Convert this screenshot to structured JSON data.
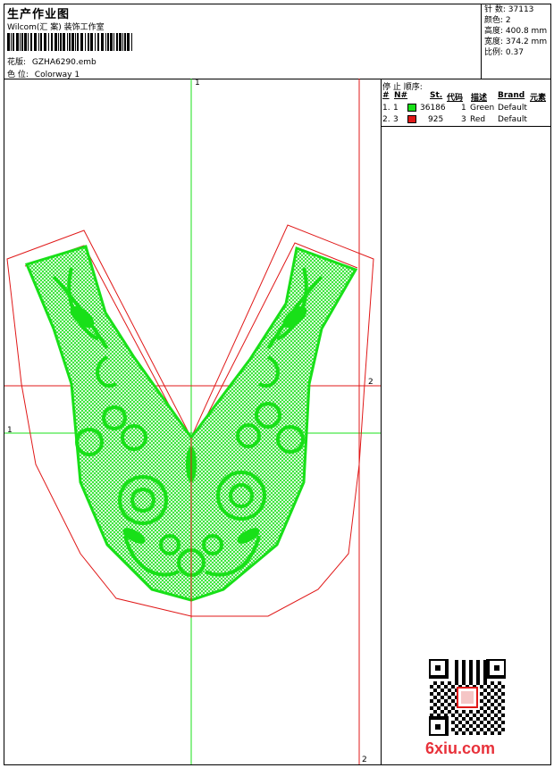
{
  "header": {
    "title": "生产作业图",
    "company": "Wilcom(汇 案) 装饰工作室",
    "design_label": "花版:",
    "design_value": "GZHA6290.emb",
    "colorway_label": "色 位:",
    "colorway_value": "Colorway 1"
  },
  "stats": {
    "stitches_label": "针 数:",
    "stitches_value": "37113",
    "colors_label": "颜色:",
    "colors_value": "2",
    "height_label": "高度:",
    "height_value": "400.8 mm",
    "width_label": "宽度:",
    "width_value": "374.2 mm",
    "scale_label": "比例:",
    "scale_value": "0.37"
  },
  "sequence": {
    "title": "停 止 顺序:",
    "headers": {
      "seq": "#",
      "no": "N#",
      "st": "St.",
      "code": "代码",
      "desc": "描述",
      "brand": "Brand",
      "element": "元素"
    },
    "rows": [
      {
        "seq": "1.",
        "no": "1",
        "st": "36186",
        "code": "1",
        "desc": "Green",
        "brand": "Default",
        "color": "#18e018"
      },
      {
        "seq": "2.",
        "no": "3",
        "st": "925",
        "code": "3",
        "desc": "Red",
        "brand": "Default",
        "color": "#e01818"
      }
    ]
  },
  "markers": {
    "top": "1",
    "left": "1",
    "right": "2",
    "bottom": "2"
  },
  "footer": {
    "logo": "6xiu.com"
  },
  "colors": {
    "green": "#18e018",
    "red": "#e01818"
  }
}
